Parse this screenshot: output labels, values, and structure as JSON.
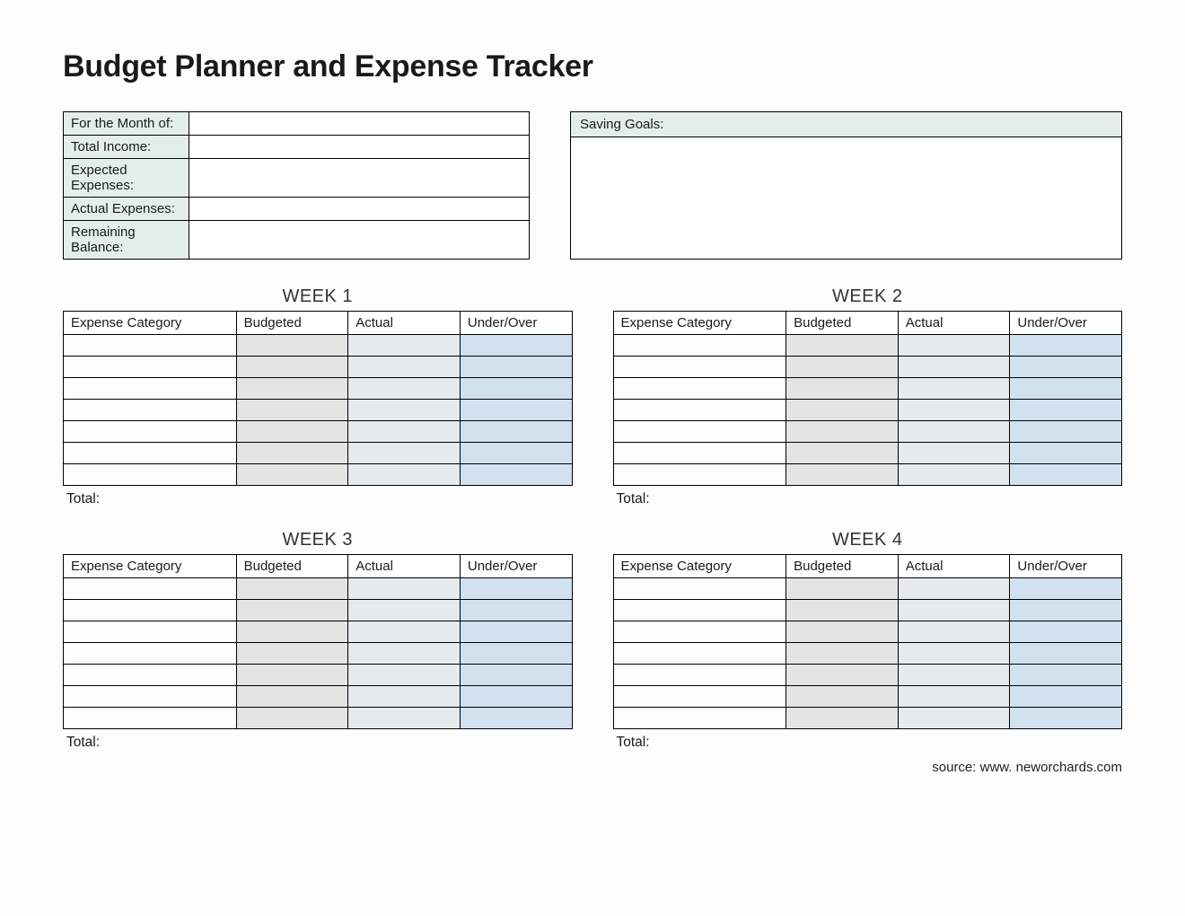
{
  "title": "Budget Planner and Expense Tracker",
  "summary": {
    "rows": [
      {
        "label": "For the Month of:",
        "value": ""
      },
      {
        "label": "Total Income:",
        "value": ""
      },
      {
        "label": "Expected Expenses:",
        "value": ""
      },
      {
        "label": "Actual Expenses:",
        "value": ""
      },
      {
        "label": "Remaining Balance:",
        "value": ""
      }
    ]
  },
  "goals": {
    "header": "Saving Goals:",
    "body": ""
  },
  "week_columns": {
    "category": "Expense Category",
    "budgeted": "Budgeted",
    "actual": "Actual",
    "under_over": "Under/Over"
  },
  "total_label": "Total:",
  "weeks": [
    {
      "title": "WEEK 1",
      "rows": [
        {
          "category": "",
          "budgeted": "",
          "actual": "",
          "under_over": ""
        },
        {
          "category": "",
          "budgeted": "",
          "actual": "",
          "under_over": ""
        },
        {
          "category": "",
          "budgeted": "",
          "actual": "",
          "under_over": ""
        },
        {
          "category": "",
          "budgeted": "",
          "actual": "",
          "under_over": ""
        },
        {
          "category": "",
          "budgeted": "",
          "actual": "",
          "under_over": ""
        },
        {
          "category": "",
          "budgeted": "",
          "actual": "",
          "under_over": ""
        },
        {
          "category": "",
          "budgeted": "",
          "actual": "",
          "under_over": ""
        }
      ],
      "total": ""
    },
    {
      "title": "WEEK 2",
      "rows": [
        {
          "category": "",
          "budgeted": "",
          "actual": "",
          "under_over": ""
        },
        {
          "category": "",
          "budgeted": "",
          "actual": "",
          "under_over": ""
        },
        {
          "category": "",
          "budgeted": "",
          "actual": "",
          "under_over": ""
        },
        {
          "category": "",
          "budgeted": "",
          "actual": "",
          "under_over": ""
        },
        {
          "category": "",
          "budgeted": "",
          "actual": "",
          "under_over": ""
        },
        {
          "category": "",
          "budgeted": "",
          "actual": "",
          "under_over": ""
        },
        {
          "category": "",
          "budgeted": "",
          "actual": "",
          "under_over": ""
        }
      ],
      "total": ""
    },
    {
      "title": "WEEK 3",
      "rows": [
        {
          "category": "",
          "budgeted": "",
          "actual": "",
          "under_over": ""
        },
        {
          "category": "",
          "budgeted": "",
          "actual": "",
          "under_over": ""
        },
        {
          "category": "",
          "budgeted": "",
          "actual": "",
          "under_over": ""
        },
        {
          "category": "",
          "budgeted": "",
          "actual": "",
          "under_over": ""
        },
        {
          "category": "",
          "budgeted": "",
          "actual": "",
          "under_over": ""
        },
        {
          "category": "",
          "budgeted": "",
          "actual": "",
          "under_over": ""
        },
        {
          "category": "",
          "budgeted": "",
          "actual": "",
          "under_over": ""
        }
      ],
      "total": ""
    },
    {
      "title": "WEEK 4",
      "rows": [
        {
          "category": "",
          "budgeted": "",
          "actual": "",
          "under_over": ""
        },
        {
          "category": "",
          "budgeted": "",
          "actual": "",
          "under_over": ""
        },
        {
          "category": "",
          "budgeted": "",
          "actual": "",
          "under_over": ""
        },
        {
          "category": "",
          "budgeted": "",
          "actual": "",
          "under_over": ""
        },
        {
          "category": "",
          "budgeted": "",
          "actual": "",
          "under_over": ""
        },
        {
          "category": "",
          "budgeted": "",
          "actual": "",
          "under_over": ""
        },
        {
          "category": "",
          "budgeted": "",
          "actual": "",
          "under_over": ""
        }
      ],
      "total": ""
    }
  ],
  "source": "source: www. neworchards.com"
}
